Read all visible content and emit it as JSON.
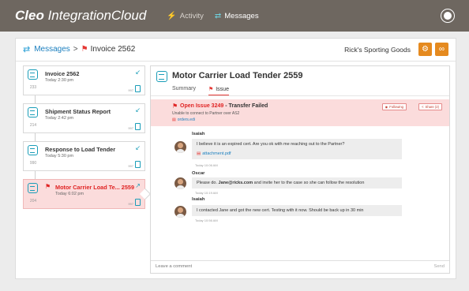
{
  "app": {
    "brand_bold": "Cleo",
    "brand_light": " IntegrationCloud"
  },
  "nav": [
    {
      "label": "Activity",
      "icon": "activity-icon"
    },
    {
      "label": "Messages",
      "icon": "swap-arrows-icon"
    }
  ],
  "breadcrumb": {
    "root": "Messages",
    "separator": ">",
    "current": "Invoice 2562"
  },
  "company": "Rick's Sporting Goods",
  "list": [
    {
      "number": "233",
      "title": "Invoice 2562",
      "time": "Today 2:30 pm",
      "format": "997"
    },
    {
      "number": "214",
      "title": "Shipment Status Report",
      "time": "Today 2:42 pm",
      "format": "997"
    },
    {
      "number": "990",
      "title": "Response to Load Tender",
      "time": "Today 5:30 pm",
      "format": "997"
    },
    {
      "number": "204",
      "title": "Motor Carrier Load Te... 2559",
      "time": "Today 6:02 pm",
      "format": "997"
    }
  ],
  "detail": {
    "title": "Motor Carrier Load Tender 2559",
    "tabs": [
      "Summary",
      "Issue"
    ]
  },
  "issue": {
    "id": "Open Issue 3249",
    "status": " - Transfer Failed",
    "description": "Unable to connect to Partner over AS2",
    "file": "orders.edi",
    "follow_label": "Following",
    "share_label": "Share (2)"
  },
  "comments": [
    {
      "author": "Isaiah",
      "text": "I believe it is an expired cert. Are you ok with me reaching out to the Partner?",
      "attachment": "attachment.pdf",
      "time": "Today 10:06 AM"
    },
    {
      "author": "Oscar",
      "text_pre": "Please do. ",
      "text_bold": "Jane@ricks.com",
      "text_post": " and invite her to the case so she can follow the resolution",
      "time": "Today 10:19 AM"
    },
    {
      "author": "Isaiah",
      "text": "I contacted Jane and got the new cert. Testing with it now. Should be back up in 30 min",
      "time": "Today 10:56 AM"
    }
  ],
  "composer": {
    "placeholder": "Leave a comment",
    "send_label": "Send"
  },
  "colors": {
    "topbar": "#6e6760",
    "accent": "#1a9db8",
    "alert": "#e02424",
    "orange": "#e58a1f",
    "link": "#1b7fbf"
  }
}
